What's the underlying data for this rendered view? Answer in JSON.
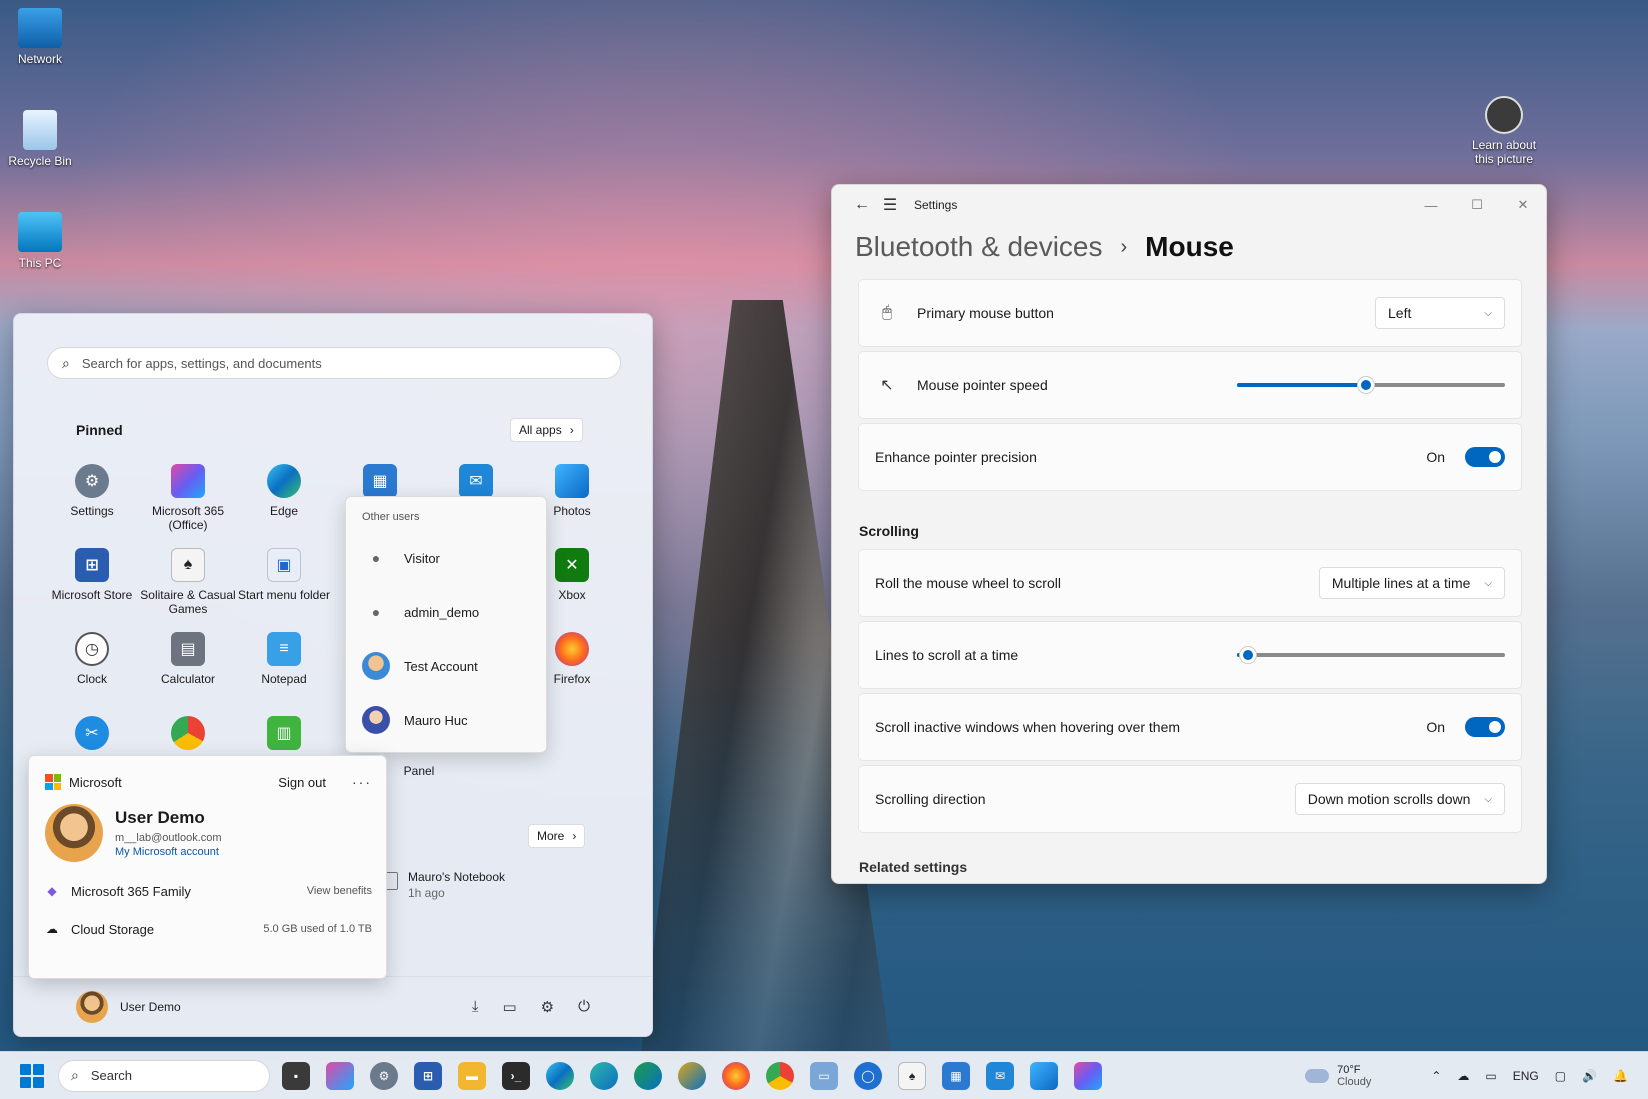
{
  "desktop": {
    "icons": [
      {
        "label": "Network"
      },
      {
        "label": "Recycle Bin"
      },
      {
        "label": "This PC"
      },
      {
        "label": "Learn about this picture"
      }
    ]
  },
  "settings": {
    "window_title": "Settings",
    "breadcrumb_parent": "Bluetooth & devices",
    "breadcrumb_sep": "›",
    "breadcrumb_current": "Mouse",
    "primary_button": {
      "label": "Primary mouse button",
      "value": "Left"
    },
    "pointer_speed": {
      "label": "Mouse pointer speed",
      "level": 0.48
    },
    "precision": {
      "label": "Enhance pointer precision",
      "state": "On"
    },
    "scrolling_title": "Scrolling",
    "roll_wheel": {
      "label": "Roll the mouse wheel to scroll",
      "value": "Multiple lines at a time"
    },
    "lines_to_scroll": {
      "label": "Lines to scroll at a time",
      "level": 0.04
    },
    "inactive_scroll": {
      "label": "Scroll inactive windows when hovering over them",
      "state": "On"
    },
    "scroll_direction": {
      "label": "Scrolling direction",
      "value": "Down motion scrolls down"
    },
    "related_title": "Related settings",
    "accent": "#0067c0"
  },
  "start": {
    "search_placeholder": "Search for apps, settings, and documents",
    "pinned_title": "Pinned",
    "all_apps": "All apps",
    "more": "More",
    "apps": [
      {
        "label": "Settings"
      },
      {
        "label": "Microsoft 365 (Office)"
      },
      {
        "label": "Edge"
      },
      {
        "label": "Photos"
      },
      {
        "label": "Microsoft Store"
      },
      {
        "label": "Solitaire & Casual Games"
      },
      {
        "label": "Start menu folder"
      },
      {
        "label": "Xbox"
      },
      {
        "label": "Clock"
      },
      {
        "label": "Calculator"
      },
      {
        "label": "Notepad"
      },
      {
        "label": "Firefox"
      },
      {
        "label": "Panel"
      }
    ],
    "recommended_item": {
      "title": "Mauro's Notebook",
      "sub": "1h ago"
    },
    "footer_user": "User Demo"
  },
  "users_flyout": {
    "title": "Other users",
    "users": [
      {
        "name": "Visitor"
      },
      {
        "name": "admin_demo"
      },
      {
        "name": "Test Account"
      },
      {
        "name": "Mauro Huc"
      }
    ]
  },
  "account": {
    "brand": "Microsoft",
    "sign_out": "Sign out",
    "more": "···",
    "name": "User Demo",
    "email": "m__lab@outlook.com",
    "link": "My Microsoft account",
    "rows": [
      {
        "label": "Microsoft 365 Family",
        "value": "View benefits"
      },
      {
        "label": "Cloud Storage",
        "value": "5.0 GB used of 1.0 TB"
      }
    ]
  },
  "taskbar": {
    "search_label": "Search",
    "weather_temp": "70°F",
    "weather_text": "Cloudy",
    "lang": "ENG"
  }
}
